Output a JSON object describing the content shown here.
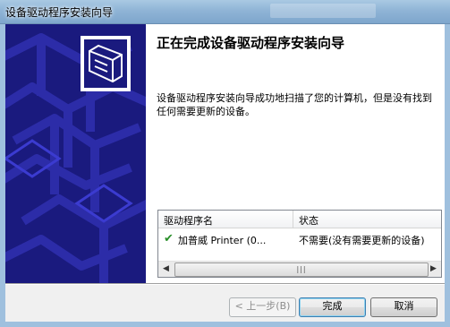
{
  "window": {
    "title": "设备驱动程序安装向导"
  },
  "heading": "正在完成设备驱动程序安装向导",
  "message": "设备驱动程序安装向导成功地扫描了您的计算机，但是没有找到任何需要更新的设备。",
  "list": {
    "columns": [
      "驱动程序名",
      "状态"
    ],
    "rows": [
      {
        "name": "加普威 Printer  (0...",
        "status": "不需要(没有需要更新的设备)"
      }
    ]
  },
  "buttons": {
    "back": "< 上一步(B)",
    "finish": "完成",
    "cancel": "取消"
  },
  "colors": {
    "banner": "#1a1a7e",
    "accent_check": "#2a8f2a"
  }
}
